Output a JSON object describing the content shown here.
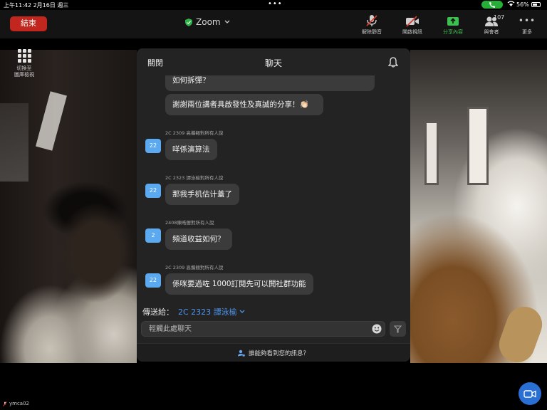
{
  "status_bar": {
    "time": "上午11:42  2月16日 週三",
    "battery": "56%"
  },
  "toolbar": {
    "end_label": "結束",
    "app_title": "Zoom",
    "mute_label": "解除靜音",
    "video_label": "開啟視訊",
    "share_label": "分享內容",
    "participants_label": "與會者",
    "participants_count": "107",
    "more_label": "更多",
    "accent_share": "#3cc04f",
    "end_color": "#c1271f"
  },
  "gallery": {
    "label": "切換至\n圖庫檢視"
  },
  "self_view": {
    "name": "ymca02"
  },
  "chat": {
    "close_label": "關閉",
    "title": "聊天",
    "messages": [
      {
        "sender": "",
        "avatar": "",
        "text": "如何拆彈？"
      },
      {
        "sender": "",
        "avatar": "",
        "text": "謝謝兩位講者具啟發性及真誠的分享！👏🏻"
      },
      {
        "sender": "2C 2309 高攜翹對所有人說",
        "avatar": "22",
        "text": "咩係演算法"
      },
      {
        "sender": "2C 2323 譚泳榆對所有人說",
        "avatar": "22",
        "text": "那我手机估计蓋了"
      },
      {
        "sender": "2408陳晧鏗對所有人說",
        "avatar": "2",
        "text": "頻道收益如何？"
      },
      {
        "sender": "2C 2309 高攜翹對所有人說",
        "avatar": "22",
        "text": "係咪要過咗 1000訂閱先可以開社群功能"
      }
    ],
    "send_to_label": "傳送給：",
    "send_to_target": "2C 2323 譚泳榆",
    "input_placeholder": "輕觸此處聊天",
    "footer_label": "誰能夠看到您的訊息？",
    "accent_link": "#4d94ec",
    "avatar_color": "#5aa9f1"
  }
}
